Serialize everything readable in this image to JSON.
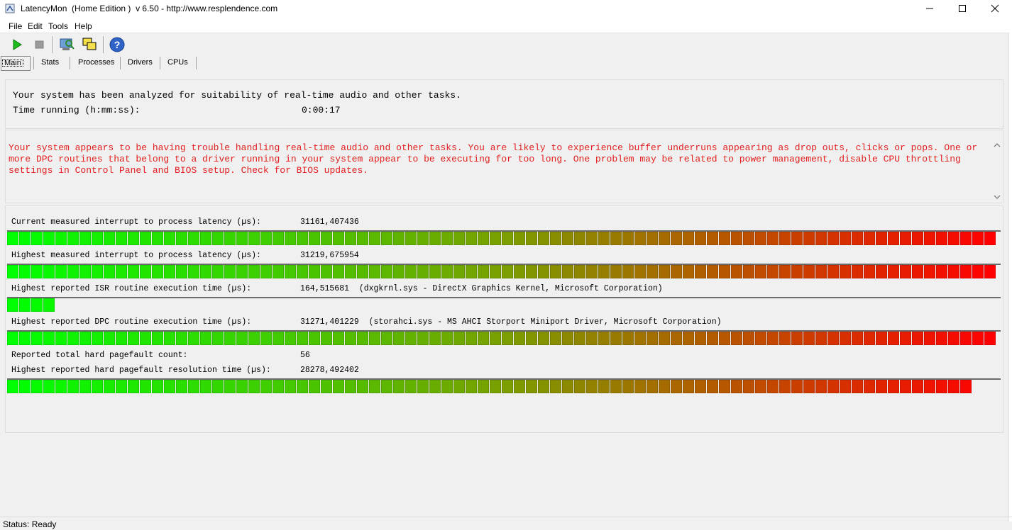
{
  "window": {
    "title": "LatencyMon  (Home Edition )  v 6.50 - http://www.resplendence.com",
    "minimize": "—",
    "maximize": "☐",
    "close": "✕"
  },
  "menu": [
    {
      "label": "File"
    },
    {
      "label": "Edit"
    },
    {
      "label": "Tools"
    },
    {
      "label": "Help"
    }
  ],
  "toolbar": {
    "start_icon": "play-icon",
    "stop_icon": "stop-icon",
    "tools_icon": "analyzer-icon",
    "windows_icon": "windows-icon",
    "help_icon": "help-icon"
  },
  "tabs": [
    {
      "label": "Main",
      "active": true
    },
    {
      "label": "Stats",
      "active": false
    },
    {
      "label": "Processes",
      "active": false
    },
    {
      "label": "Drivers",
      "active": false
    },
    {
      "label": "CPUs",
      "active": false
    }
  ],
  "summary": {
    "line1": "Your system has been analyzed for suitability of real-time audio and other tasks.",
    "time_label": "Time running (h:mm:ss):",
    "time_value": "0:00:17"
  },
  "warning": {
    "text": "Your system appears to be having trouble handling real-time audio and other tasks. You are likely to experience buffer underruns appearing as drop outs, clicks or pops. One or more DPC routines that belong to a driver running in your system appear to be executing for too long. One problem may be related to power management, disable CPU throttling settings in Control Panel and BIOS setup. Check for BIOS updates.",
    "color": "#e31e1e"
  },
  "metrics": {
    "current_latency": {
      "label": "Current measured interrupt to process latency (µs):",
      "value": "31161,407436",
      "fill": 1.0
    },
    "highest_latency": {
      "label": "Highest measured interrupt to process latency (µs):",
      "value": "31219,675954",
      "fill": 1.0
    },
    "isr": {
      "label": "Highest reported ISR routine execution time (µs):",
      "value": "164,515681  (dxgkrnl.sys - DirectX Graphics Kernel, Microsoft Corporation)",
      "fill": 0.05
    },
    "dpc": {
      "label": "Highest reported DPC routine execution time (µs):",
      "value": "31271,401229  (storahci.sys - MS AHCI Storport Miniport Driver, Microsoft Corporation)",
      "fill": 1.0
    },
    "pagefault_count": {
      "label": "Reported total hard pagefault count:",
      "value": "56"
    },
    "pagefault_time": {
      "label": "Highest reported hard pagefault resolution time (µs):",
      "value": "28278,492402",
      "fill": 0.98
    }
  },
  "colors": {
    "meter_start": "#00ff00",
    "meter_mid": "#7aa000",
    "meter_end": "#ff0000",
    "warning": "#e31e1e"
  },
  "status": {
    "text": "Status: Ready"
  }
}
